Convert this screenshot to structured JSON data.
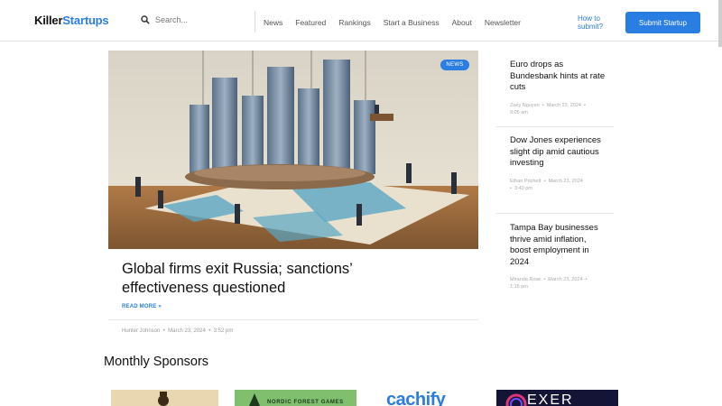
{
  "header": {
    "logo_part1": "Killer",
    "logo_part2": "Startups",
    "search_placeholder": "Search...",
    "nav": [
      "News",
      "Featured",
      "Rankings",
      "Start a Business",
      "About",
      "Newsletter"
    ],
    "how_to_submit": "How to submit?",
    "submit_button": "Submit Startup"
  },
  "hero": {
    "badge": "NEWS",
    "title": "Global firms exit Russia; sanctions’ effectiveness questioned",
    "read_more": "READ MORE »",
    "author": "Hunter Johnson",
    "date": "March 23, 2024",
    "time": "3:52 pm"
  },
  "side_articles": [
    {
      "title": "Euro drops as Bundesbank hints at rate cuts",
      "author": "Zoey Nguyen",
      "date": "March 23, 2024",
      "time": "9:05 am"
    },
    {
      "title": "Dow Jones experiences slight dip amid cautious investing",
      "author": "Ethan Prichett",
      "date": "March 23, 2024",
      "time": "3:40 pm"
    },
    {
      "title": "Tampa Bay businesses thrive amid inflation, boost employment in 2024",
      "author": "Miranda Rose",
      "date": "March 23, 2024",
      "time": "1:15 pm"
    }
  ],
  "sponsors": {
    "title": "Monthly Sponsors",
    "items": [
      "",
      "NORDIC FOREST GAMES",
      "cachify",
      "EXER"
    ]
  },
  "colors": {
    "accent": "#2a7de1",
    "text": "#111111",
    "muted": "#999999"
  }
}
